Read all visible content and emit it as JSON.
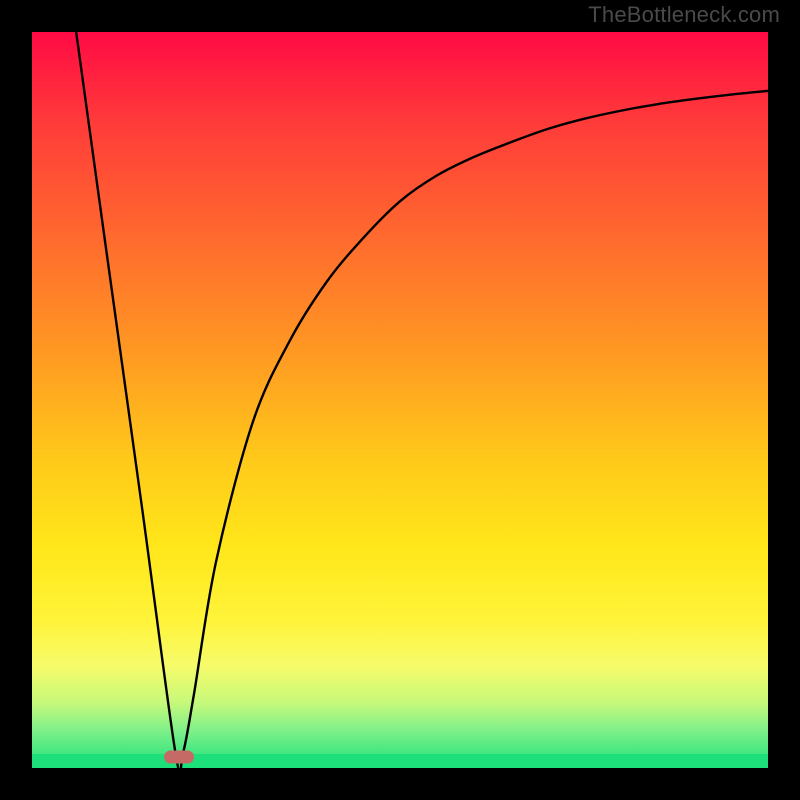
{
  "watermark": "TheBottleneck.com",
  "chart_data": {
    "type": "line",
    "title": "",
    "xlabel": "",
    "ylabel": "",
    "xlim": [
      0,
      100
    ],
    "ylim": [
      0,
      100
    ],
    "grid": false,
    "legend": null,
    "background_gradient": {
      "top_color": "#ff0a44",
      "note": "red at top through orange/yellow to green at bottom",
      "bottom_color": "#1de07a"
    },
    "series": [
      {
        "name": "bottleneck-curve",
        "note": "V-shaped curve: steep linear left branch, asymptotic right branch",
        "x": [
          6,
          10,
          15,
          19.5,
          20.5,
          22,
          25,
          30,
          35,
          40,
          45,
          50,
          55,
          60,
          65,
          70,
          75,
          80,
          85,
          90,
          95,
          100
        ],
        "y": [
          100,
          71,
          35,
          2,
          2,
          10,
          28,
          47,
          58,
          66,
          72,
          77,
          80.5,
          83,
          85,
          86.8,
          88.2,
          89.3,
          90.2,
          90.9,
          91.5,
          92
        ]
      }
    ],
    "marker": {
      "name": "optimal-point",
      "x": 20,
      "y": 1.5,
      "color": "#c66a66",
      "shape": "rounded-rect"
    }
  }
}
